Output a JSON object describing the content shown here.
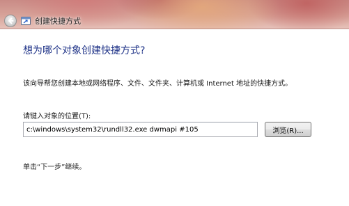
{
  "window": {
    "title": "创建快捷方式",
    "icons": {
      "back": "back-arrow-icon",
      "wizard": "shortcut-wizard-icon"
    }
  },
  "page": {
    "heading": "想为哪个对象创建快捷方式?",
    "description": "该向导帮您创建本地或网络程序、文件、文件夹、计算机或 Internet 地址的快捷方式。",
    "location_label": "请键入对象的位置(T):",
    "location_value": "c:\\windows\\system32\\rundll32.exe dwmapi #105",
    "browse_label": "浏览(R)...",
    "hint": "单击“下一步”继续。"
  },
  "colors": {
    "heading": "#1e3287",
    "titlebar": "#d8a49a"
  }
}
